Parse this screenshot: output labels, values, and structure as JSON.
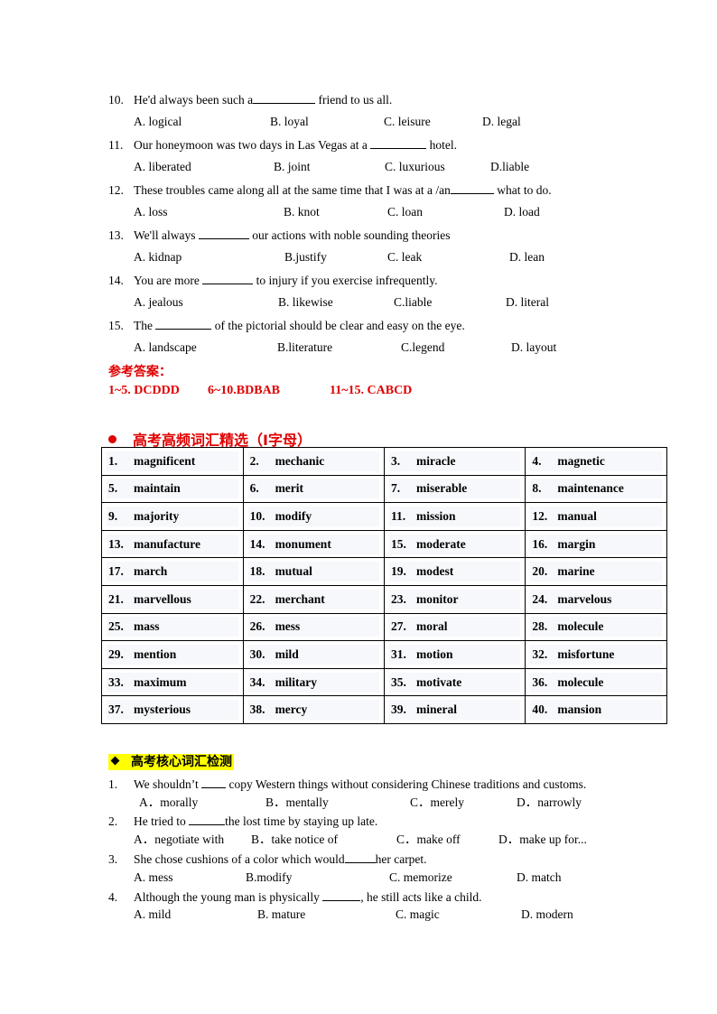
{
  "part1": {
    "questions": [
      {
        "num": "10.",
        "pre": "He'd always been such a",
        "post": " friend to us all.",
        "options": [
          "A. logical",
          "B. loyal",
          "C. leisure",
          "D. legal"
        ]
      },
      {
        "num": "11.",
        "pre": "Our honeymoon was two days in Las Vegas at a ",
        "post": " hotel.",
        "options": [
          "A. liberated",
          "B. joint",
          "C. luxurious",
          "D.liable"
        ]
      },
      {
        "num": "12.",
        "pre": "These troubles came along all at the same time that I was at a /an",
        "post": " what to do.",
        "options": [
          "A. loss",
          "B. knot",
          "C. loan",
          "D. load"
        ]
      },
      {
        "num": "13.",
        "pre": "We'll always ",
        "post": " our actions with noble sounding theories",
        "options": [
          "A. kidnap",
          "B.justify",
          "C. leak",
          "D. lean"
        ]
      },
      {
        "num": "14.",
        "pre": "You are more ",
        "post": " to injury if you exercise infrequently.",
        "options": [
          "A. jealous",
          "B. likewise",
          "C.liable",
          "D. literal"
        ]
      },
      {
        "num": "15.",
        "pre": "The ",
        "post": " of the pictorial should be clear and easy on the eye.",
        "options": [
          "A. landscape",
          "B.literature",
          "C.legend",
          "D. layout"
        ]
      }
    ]
  },
  "answers": {
    "title": "参考答案：",
    "groups": [
      "1~5. DCDDD",
      "6~10.BDBAB",
      "11~15. CABCD"
    ]
  },
  "vocab_section": {
    "title": "高考高频词汇精选（Ⅰ字母）",
    "rows": [
      [
        [
          "1.",
          "magnificent"
        ],
        [
          "2.",
          "mechanic"
        ],
        [
          "3.",
          "miracle"
        ],
        [
          "4.",
          "magnetic"
        ]
      ],
      [
        [
          "5.",
          "maintain"
        ],
        [
          "6.",
          "merit"
        ],
        [
          "7.",
          "miserable"
        ],
        [
          "8.",
          "maintenance"
        ]
      ],
      [
        [
          "9.",
          "majority"
        ],
        [
          "10.",
          "modify"
        ],
        [
          "11.",
          "mission"
        ],
        [
          "12.",
          "manual"
        ]
      ],
      [
        [
          "13.",
          "manufacture"
        ],
        [
          "14.",
          "monument"
        ],
        [
          "15.",
          "moderate"
        ],
        [
          "16.",
          "margin"
        ]
      ],
      [
        [
          "17.",
          "march"
        ],
        [
          "18.",
          "mutual"
        ],
        [
          "19.",
          "modest"
        ],
        [
          "20.",
          "marine"
        ]
      ],
      [
        [
          "21.",
          "marvellous"
        ],
        [
          "22.",
          "merchant"
        ],
        [
          "23.",
          "monitor"
        ],
        [
          "24.",
          "marvelous"
        ]
      ],
      [
        [
          "25.",
          "mass"
        ],
        [
          "26.",
          "mess"
        ],
        [
          "27.",
          "moral"
        ],
        [
          "28.",
          "molecule"
        ]
      ],
      [
        [
          "29.",
          "mention"
        ],
        [
          "30.",
          "mild"
        ],
        [
          "31.",
          "motion"
        ],
        [
          "32.",
          "misfortune"
        ]
      ],
      [
        [
          "33.",
          "maximum"
        ],
        [
          "34.",
          "military"
        ],
        [
          "35.",
          "motivate"
        ],
        [
          "36.",
          "molecule"
        ]
      ],
      [
        [
          "37.",
          "mysterious"
        ],
        [
          "38.",
          "mercy"
        ],
        [
          "39.",
          "mineral"
        ],
        [
          "40.",
          "mansion"
        ]
      ]
    ]
  },
  "core_section": {
    "title": "高考核心词汇检测",
    "questions": [
      {
        "num": "1.",
        "pre": "We shouldn’t ",
        "post": " copy Western things without considering Chinese traditions and customs.",
        "options": [
          "A．morally",
          "B．mentally",
          "C．merely",
          "D．narrowly"
        ]
      },
      {
        "num": "2.",
        "pre": "He tried to ",
        "post": "the lost time by staying up late.",
        "options": [
          "A．negotiate with",
          "B．take notice of",
          "C．make off",
          "D．make up for..."
        ]
      },
      {
        "num": "3.",
        "pre": "She chose cushions of a color which would",
        "post": "her carpet.",
        "options": [
          "A. mess",
          "B.modify",
          "C. memorize",
          "D. match"
        ]
      },
      {
        "num": "4.",
        "pre": "Although the young man is physically ",
        "post": ", he still acts like a child.",
        "options": [
          "A.  mild",
          "B. mature",
          "C. magic",
          "D. modern"
        ]
      }
    ]
  },
  "colors": {
    "accent_red": "#e00000",
    "highlight_yellow": "#ffff00"
  }
}
